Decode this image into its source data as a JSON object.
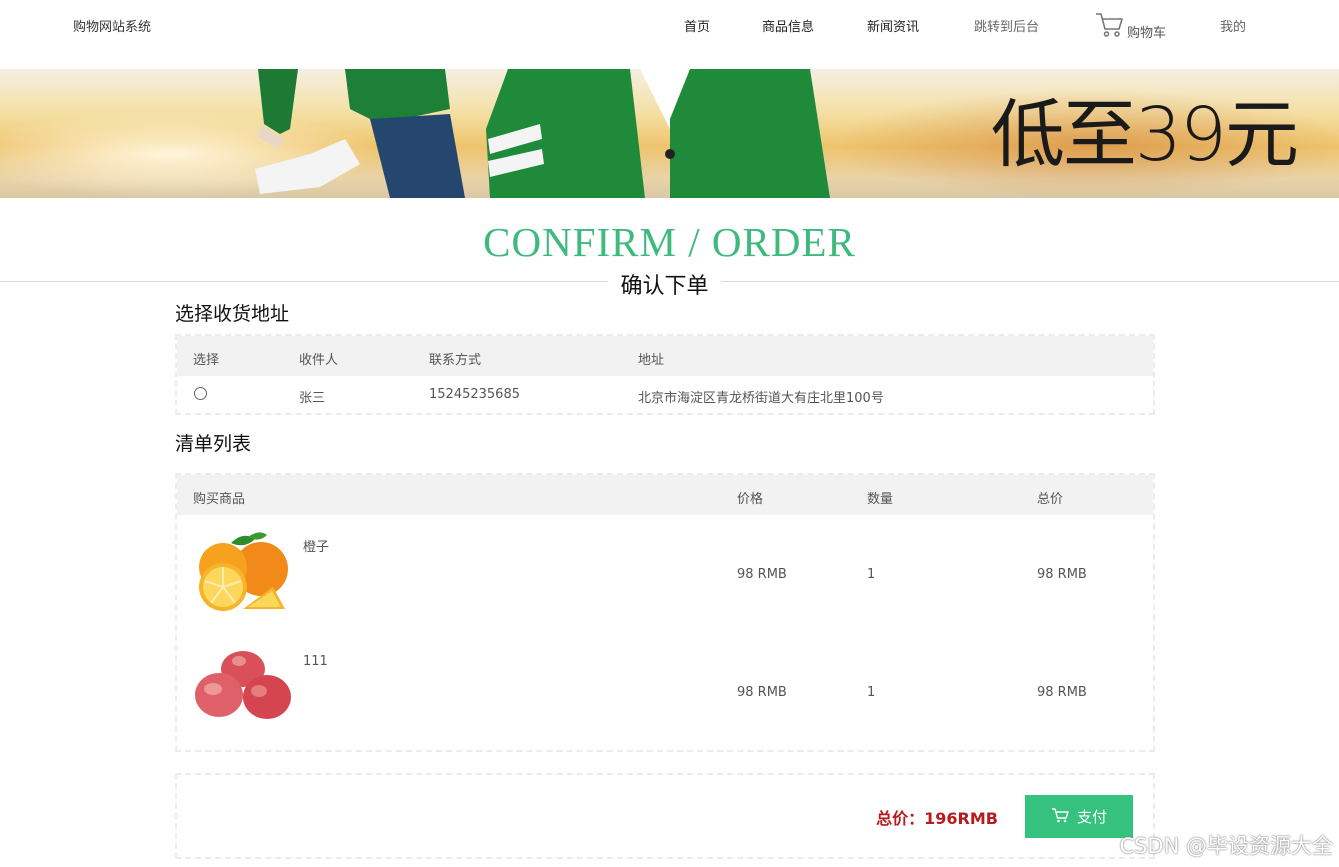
{
  "header": {
    "site_title": "购物网站系统",
    "nav": {
      "home": "首页",
      "products": "商品信息",
      "news": "新闻资讯",
      "admin": "跳转到后台",
      "cart": "购物车",
      "mine": "我的"
    }
  },
  "banner": {
    "text": "低至39元"
  },
  "title": {
    "en": "CONFIRM / ORDER",
    "cn": "确认下单"
  },
  "address_section": {
    "heading": "选择收货地址",
    "columns": {
      "select": "选择",
      "receiver": "收件人",
      "contact": "联系方式",
      "address": "地址"
    },
    "rows": [
      {
        "receiver": "张三",
        "contact": "15245235685",
        "address": "北京市海淀区青龙桥街道大有庄北里100号"
      }
    ]
  },
  "order_section": {
    "heading": "清单列表",
    "columns": {
      "product": "购买商品",
      "price": "价格",
      "qty": "数量",
      "total": "总价"
    },
    "items": [
      {
        "name": "橙子",
        "price": "98 RMB",
        "qty": "1",
        "total": "98 RMB",
        "image": "orange-image"
      },
      {
        "name": "111",
        "price": "98 RMB",
        "qty": "1",
        "total": "98 RMB",
        "image": "apple-image"
      }
    ]
  },
  "checkout": {
    "total_label": "总价：196RMB",
    "pay_label": "支付"
  },
  "watermark": "CSDN @毕设资源大全",
  "colors": {
    "accent": "#35c17e",
    "title_green": "#3fba7f",
    "total_red": "#b41d1d"
  }
}
